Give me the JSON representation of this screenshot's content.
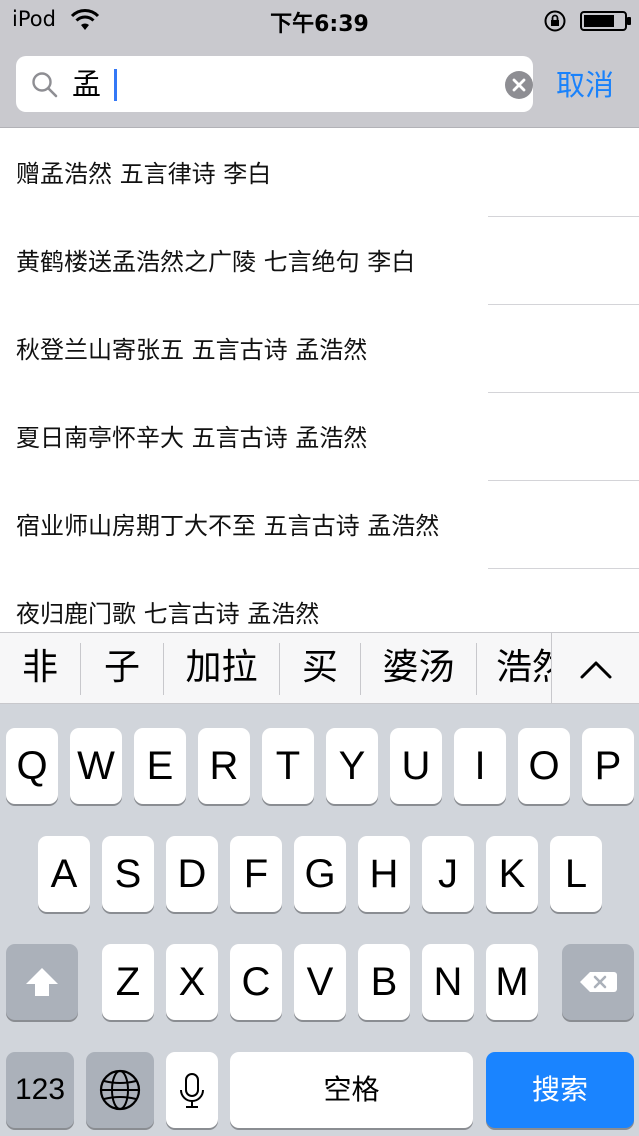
{
  "status_bar": {
    "carrier": "iPod",
    "time": "下午6:39",
    "icons": [
      "wifi-icon",
      "rotation-lock-icon",
      "battery-icon"
    ]
  },
  "search": {
    "query": "孟",
    "cancel_label": "取消"
  },
  "results": [
    {
      "text": "赠孟浩然 五言律诗 李白"
    },
    {
      "text": "黄鹤楼送孟浩然之广陵 七言绝句 李白"
    },
    {
      "text": "秋登兰山寄张五 五言古诗 孟浩然"
    },
    {
      "text": "夏日南亭怀辛大 五言古诗 孟浩然"
    },
    {
      "text": "宿业师山房期丁大不至 五言古诗 孟浩然"
    },
    {
      "text": "夜归鹿门歌 七言古诗 孟浩然"
    }
  ],
  "candidates": [
    "非",
    "子",
    "加拉",
    "买",
    "婆汤",
    "浩然"
  ],
  "keyboard": {
    "row1": [
      "Q",
      "W",
      "E",
      "R",
      "T",
      "Y",
      "U",
      "I",
      "O",
      "P"
    ],
    "row2": [
      "A",
      "S",
      "D",
      "F",
      "G",
      "H",
      "J",
      "K",
      "L"
    ],
    "row3": [
      "Z",
      "X",
      "C",
      "V",
      "B",
      "N",
      "M"
    ],
    "numbers_label": "123",
    "space_label": "空格",
    "search_label": "搜索"
  },
  "colors": {
    "accent": "#1a82fb",
    "search_key": "#1a84ff",
    "keyboard_bg": "#d1d5db",
    "topbar_bg": "#c9c9ce"
  }
}
